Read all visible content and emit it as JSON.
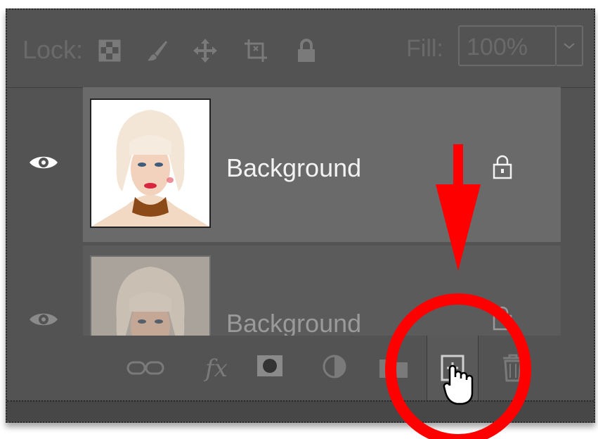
{
  "lock_bar": {
    "lock_label": "Lock:",
    "fill_label": "Fill:",
    "fill_value": "100%"
  },
  "layers": [
    {
      "name": "Background",
      "visible": true,
      "locked": true
    },
    {
      "name": "Background",
      "visible": true,
      "locked": true
    }
  ],
  "colors": {
    "panel_bg": "#535353",
    "selected_row": "#6a6a6a",
    "annotation_red": "#ff0000"
  }
}
